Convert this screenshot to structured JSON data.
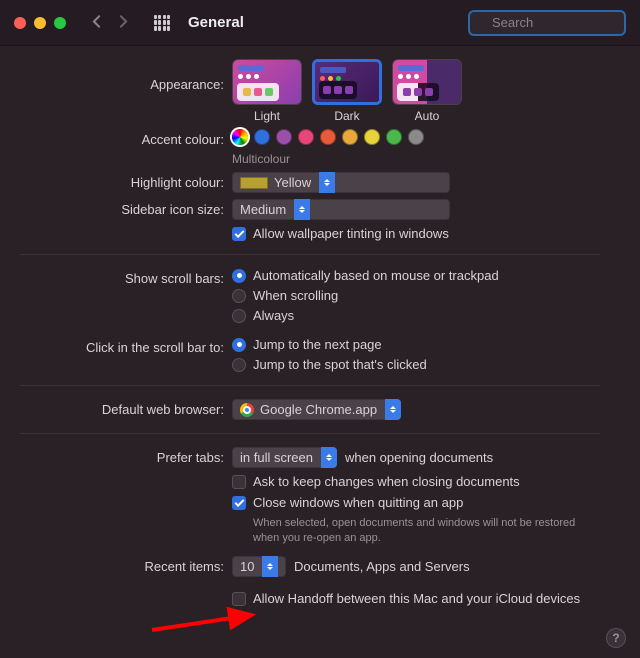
{
  "titlebar": {
    "title": "General",
    "search_placeholder": "Search"
  },
  "appearance": {
    "label": "Appearance:",
    "options": [
      "Light",
      "Dark",
      "Auto"
    ],
    "selected": "Dark"
  },
  "accent": {
    "label": "Accent colour:",
    "caption": "Multicolour",
    "colors": [
      "multi",
      "#2f6fde",
      "#9a4fa8",
      "#e8467a",
      "#e85a3a",
      "#e8a83a",
      "#e8d43a",
      "#4ab84a",
      "#8a8a8a"
    ]
  },
  "highlight": {
    "label": "Highlight colour:",
    "value": "Yellow"
  },
  "sidebar_size": {
    "label": "Sidebar icon size:",
    "value": "Medium"
  },
  "tinting": {
    "label": "Allow wallpaper tinting in windows",
    "checked": true
  },
  "scrollbars": {
    "label": "Show scroll bars:",
    "options": [
      "Automatically based on mouse or trackpad",
      "When scrolling",
      "Always"
    ],
    "selected": 0
  },
  "scroll_click": {
    "label": "Click in the scroll bar to:",
    "options": [
      "Jump to the next page",
      "Jump to the spot that's clicked"
    ],
    "selected": 0
  },
  "browser": {
    "label": "Default web browser:",
    "value": "Google Chrome.app"
  },
  "tabs": {
    "label": "Prefer tabs:",
    "value": "in full screen",
    "suffix": "when opening documents"
  },
  "ask_changes": {
    "label": "Ask to keep changes when closing documents",
    "checked": false
  },
  "close_windows": {
    "label": "Close windows when quitting an app",
    "checked": true,
    "note": "When selected, open documents and windows will not be restored when you re-open an app."
  },
  "recent": {
    "label": "Recent items:",
    "value": "10",
    "suffix": "Documents, Apps and Servers"
  },
  "handoff": {
    "label": "Allow Handoff between this Mac and your iCloud devices",
    "checked": false
  },
  "help": "?"
}
